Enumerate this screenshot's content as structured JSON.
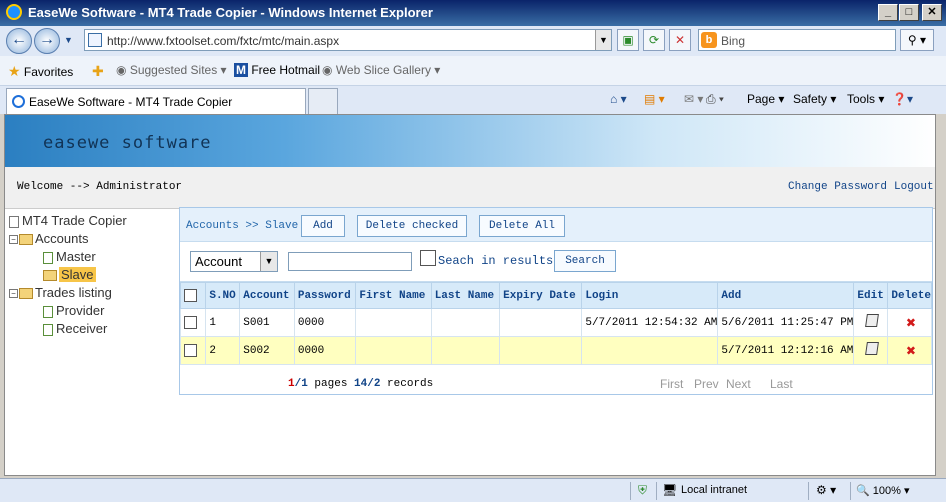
{
  "window": {
    "title": "EaseWe Software - MT4 Trade Copier - Windows Internet Explorer",
    "controls": [
      "_",
      "□",
      "✕"
    ]
  },
  "browser": {
    "url": "http://www.fxtoolset.com/fxtc/mtc/main.aspx",
    "search_placeholder": "Bing",
    "favorites_label": "Favorites",
    "favorites": [
      "Suggested Sites ▾",
      "Free Hotmail",
      "Web Slice Gallery ▾"
    ],
    "tab_title": "EaseWe Software - MT4 Trade Copier",
    "commands": [
      "Page ▾",
      "Safety ▾",
      "Tools ▾"
    ]
  },
  "site": {
    "logo": "easewe software",
    "welcome": "Welcome --> Administrator",
    "change_password": "Change Password",
    "logout": "Logout"
  },
  "tree": {
    "root": "MT4 Trade Copier",
    "accounts": "Accounts",
    "master": "Master",
    "slave": "Slave",
    "trades": "Trades listing",
    "provider": "Provider",
    "receiver": "Receiver"
  },
  "toolbar": {
    "breadcrumb": "Accounts >> Slave",
    "add": "Add",
    "delete_checked": "Delete checked",
    "delete_all": "Delete All",
    "filter_field": "Account",
    "search_in_results": "Seach in results",
    "search_button": "Search"
  },
  "grid": {
    "headers": [
      "S.NO",
      "Account",
      "Password",
      "First Name",
      "Last Name",
      "Expiry Date",
      "Login",
      "Add",
      "Edit",
      "Delete"
    ],
    "rows": [
      {
        "sno": "1",
        "account": "S001",
        "password": "0000",
        "first": "",
        "last": "",
        "expiry": "",
        "login": "5/7/2011 12:54:32 AM",
        "add": "5/6/2011 11:25:47 PM"
      },
      {
        "sno": "2",
        "account": "S002",
        "password": "0000",
        "first": "",
        "last": "",
        "expiry": "",
        "login": "",
        "add": "5/7/2011 12:12:16 AM"
      }
    ]
  },
  "pager": {
    "page_current": "1",
    "page_total": "/1",
    "pages_word": " pages ",
    "rec_current": "14",
    "rec_total": "/2",
    "records_word": " records",
    "first": "First",
    "prev": "Prev",
    "next": "Next",
    "last": "Last"
  },
  "status": {
    "zone": "Local intranet",
    "zoom": "100%"
  },
  "colors": {
    "accent": "#114488",
    "row_alt": "#ffffc0",
    "header": "#d7eaf9"
  }
}
